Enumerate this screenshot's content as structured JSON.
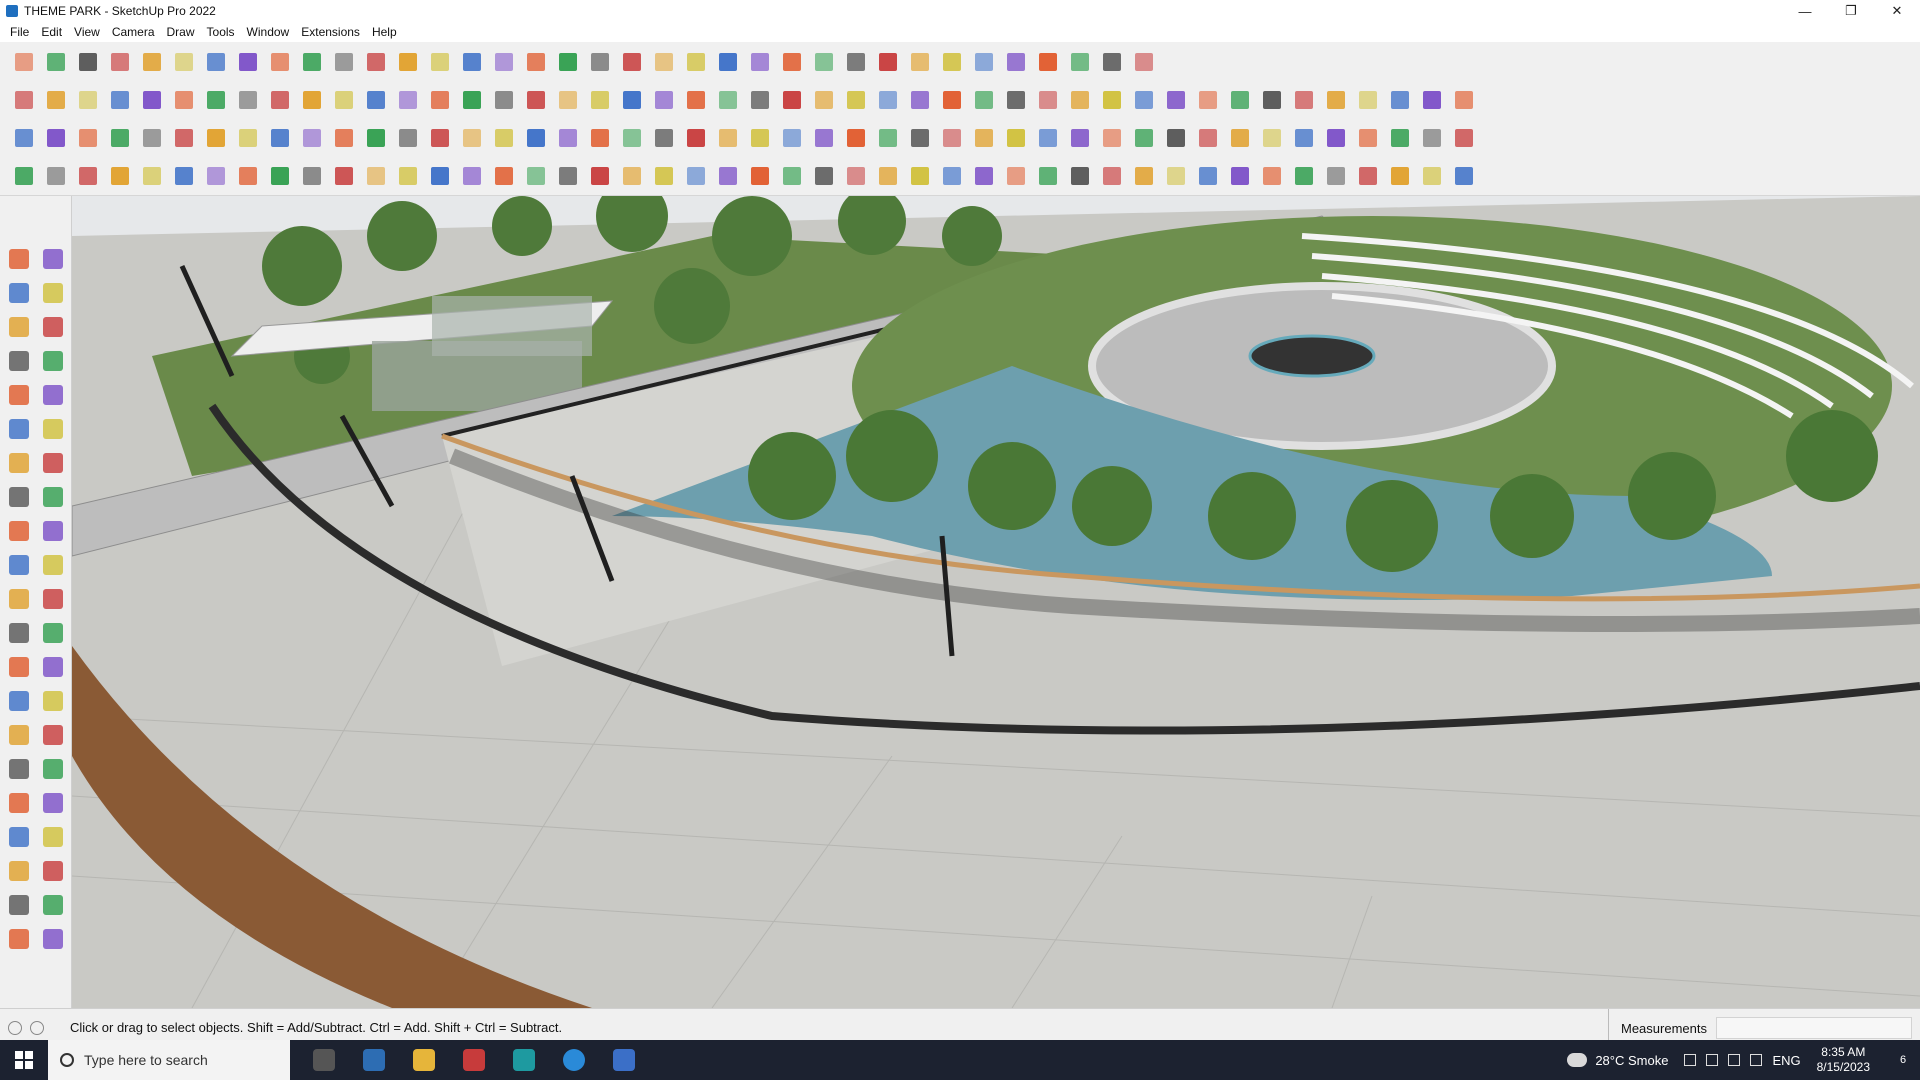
{
  "window": {
    "title": "THEME PARK - SketchUp Pro 2022",
    "minimize_glyph": "—",
    "restore_glyph": "❐",
    "close_glyph": "✕"
  },
  "menu": [
    "File",
    "Edit",
    "View",
    "Camera",
    "Draw",
    "Tools",
    "Window",
    "Extensions",
    "Help"
  ],
  "toolbar": {
    "row1_count": 36,
    "row2_count": 46,
    "row3_count": 46,
    "row4_count": 46,
    "accent_colors": [
      "#e05a2b",
      "#c73b3b",
      "#3b6fc7",
      "#2f9e4d",
      "#e0a02b",
      "#7b4fc7",
      "#555555",
      "#d0c03a"
    ]
  },
  "left_tools": [
    "select-icon",
    "orbit-icon",
    "paint-bucket-icon",
    "eraser-icon",
    "component-icon",
    "tape-measure-icon",
    "line-icon",
    "freehand-icon",
    "rectangle-icon",
    "rotated-rectangle-icon",
    "circle-icon",
    "polygon-icon",
    "arc-icon",
    "two-point-arc-icon",
    "three-point-arc-icon",
    "pie-icon",
    "move-icon",
    "push-pull-icon",
    "rotate-icon",
    "follow-me-icon",
    "scale-icon",
    "offset-icon",
    "tape-icon",
    "dimension-icon",
    "protractor-icon",
    "text-icon",
    "axes-icon",
    "3d-text-icon",
    "orbit2-icon",
    "pan-icon",
    "zoom-icon",
    "zoom-window-icon",
    "zoom-extents-icon",
    "previous-view-icon",
    "position-camera-icon",
    "look-around-icon",
    "walk-icon",
    "section-plane-icon",
    "layer-a-icon",
    "layer-b-icon",
    "layer-c-icon",
    "layer-d-icon"
  ],
  "status": {
    "hint": "Click or drag to select objects. Shift = Add/Subtract. Ctrl = Add. Shift + Ctrl = Subtract.",
    "measurements_label": "Measurements",
    "measurements_value": ""
  },
  "taskbar": {
    "search_placeholder": "Type here to search",
    "weather": "28°C  Smoke",
    "language": "ENG",
    "time": "8:35 AM",
    "date": "8/15/2023",
    "notification_count": "6"
  },
  "viewport": {
    "sky_color": "#e6e8ea",
    "paving_color": "#c7c7c3",
    "grass_color": "#6e8f4e",
    "water_color": "#6d9fae",
    "deck_color": "#8a5a35",
    "tree_color": "#4f7a3a",
    "fence_color": "#2a2a2a"
  }
}
